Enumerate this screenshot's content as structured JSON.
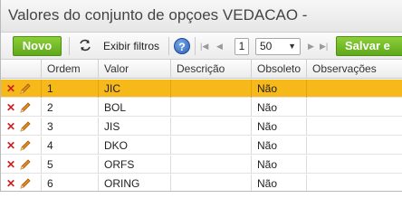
{
  "window": {
    "title": "Valores do conjunto de opçoes VEDACAO -"
  },
  "toolbar": {
    "new_label": "Novo",
    "filters_label": "Exibir filtros",
    "help_icon": "?",
    "page_number": "1",
    "page_size": "50",
    "save_label": "Salvar e",
    "colors": {
      "green": "#6cb523",
      "selected_row": "#f7b81a"
    }
  },
  "table": {
    "columns": [
      "Ordem",
      "Valor",
      "Descrição",
      "Obsoleto",
      "Observações"
    ],
    "rows": [
      {
        "ordem": "1",
        "valor": "JIC",
        "descricao": "",
        "obsoleto": "Não",
        "observacoes": ""
      },
      {
        "ordem": "2",
        "valor": "BOL",
        "descricao": "",
        "obsoleto": "Não",
        "observacoes": ""
      },
      {
        "ordem": "3",
        "valor": "JIS",
        "descricao": "",
        "obsoleto": "Não",
        "observacoes": ""
      },
      {
        "ordem": "4",
        "valor": "DKO",
        "descricao": "",
        "obsoleto": "Não",
        "observacoes": ""
      },
      {
        "ordem": "5",
        "valor": "ORFS",
        "descricao": "",
        "obsoleto": "Não",
        "observacoes": ""
      },
      {
        "ordem": "6",
        "valor": "ORING",
        "descricao": "",
        "obsoleto": "Não",
        "observacoes": ""
      }
    ],
    "selected_row": 0
  }
}
